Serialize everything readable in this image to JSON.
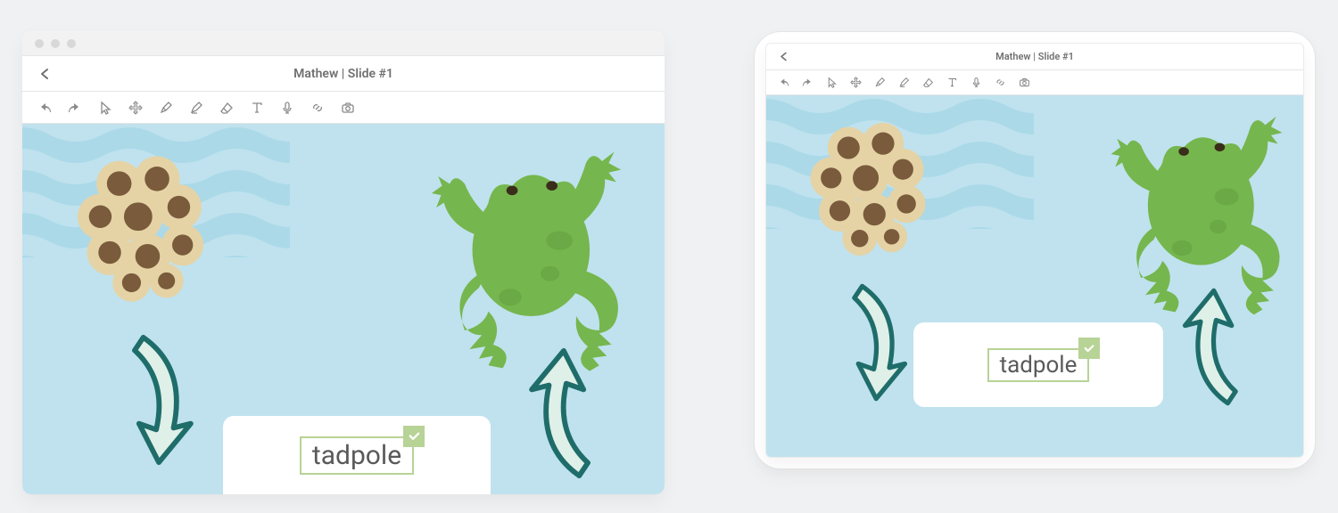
{
  "app": {
    "title": "Mathew | Slide #1"
  },
  "toolbar": {
    "items": [
      {
        "name": "undo-icon"
      },
      {
        "name": "redo-icon"
      },
      {
        "name": "pointer-icon"
      },
      {
        "name": "move-icon"
      },
      {
        "name": "pen-icon"
      },
      {
        "name": "highlighter-icon"
      },
      {
        "name": "eraser-icon"
      },
      {
        "name": "text-icon"
      },
      {
        "name": "mic-icon"
      },
      {
        "name": "link-icon"
      },
      {
        "name": "camera-icon"
      }
    ]
  },
  "slide": {
    "answer": "tadpole",
    "answer_correct": true,
    "elements": {
      "eggs": "frog-eggs-illustration",
      "frog": "frog-illustration",
      "arrow_left": "cycle-arrow-down",
      "arrow_right": "cycle-arrow-up"
    }
  },
  "colors": {
    "water": "#bfe2ee",
    "wave": "#abd9e8",
    "accent_green": "#b7d396",
    "frog_green": "#76b64e",
    "frog_green_dark": "#5e9a3b",
    "egg_tan": "#e5d3a6",
    "egg_brown": "#7a5b3c",
    "arrow_teal_dark": "#1f6d6a",
    "arrow_teal_light": "#dff0e8"
  }
}
